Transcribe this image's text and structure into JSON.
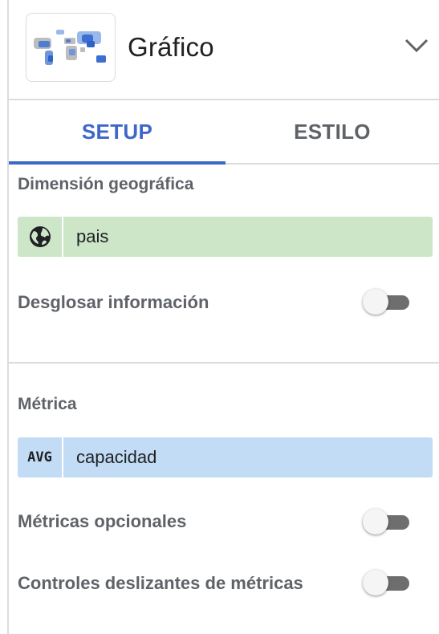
{
  "header": {
    "title": "Gráfico",
    "thumbnail_icon": "world-map-thumbnail-icon",
    "expand_icon": "chevron-down-icon"
  },
  "tabs": [
    {
      "label": "SETUP",
      "active": true
    },
    {
      "label": "ESTILO",
      "active": false
    }
  ],
  "geo_dimension": {
    "section_label": "Dimensión geográfica",
    "chip": {
      "icon": "globe-icon",
      "value": "pais",
      "color": "#cde6c8"
    },
    "drilldown": {
      "label": "Desglosar información",
      "enabled": false
    }
  },
  "metric": {
    "section_label": "Métrica",
    "chip": {
      "aggregation": "AVG",
      "value": "capacidad",
      "color": "#c2dcf5"
    },
    "optional_metrics": {
      "label": "Métricas opcionales",
      "enabled": false
    },
    "metric_sliders": {
      "label": "Controles deslizantes de métricas",
      "enabled": false
    }
  },
  "colors": {
    "accent": "#3d67c9",
    "muted_text": "#5f6368",
    "divider": "#dadce0"
  }
}
